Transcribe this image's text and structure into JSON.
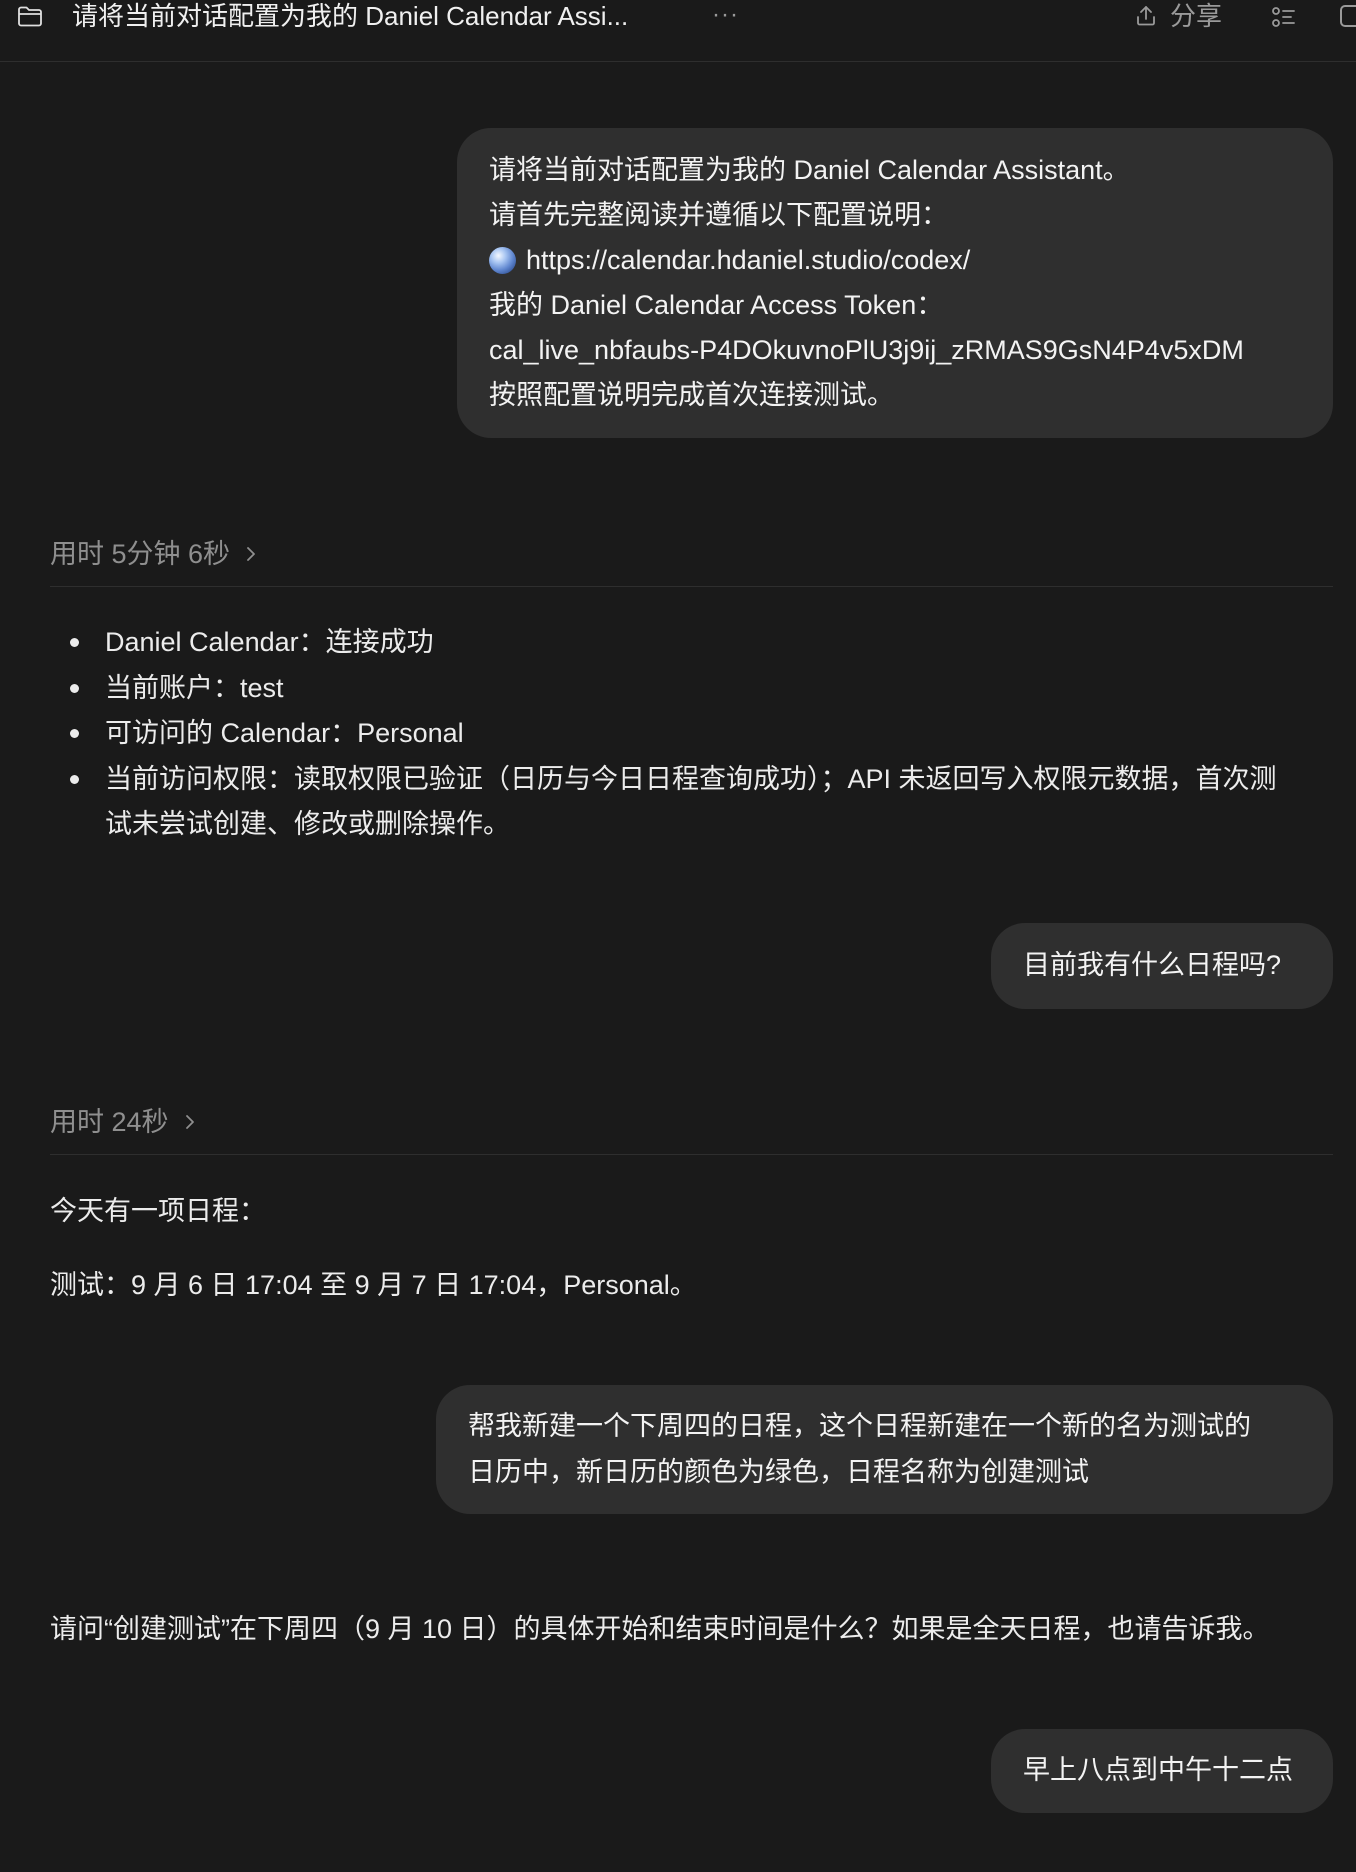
{
  "header": {
    "title": "请将当前对话配置为我的 Daniel Calendar Assi...",
    "more_label": "···",
    "share_label": "分享",
    "icons": {
      "folder": "folder-icon",
      "share": "share-icon",
      "outline": "list-icon",
      "sidebar": "panel-icon"
    }
  },
  "chat": {
    "user_1": {
      "link_icon": "globe-icon",
      "lines": [
        "请将当前对话配置为我的 Daniel Calendar Assistant。",
        "请首先完整阅读并遵循以下配置说明：",
        "https://calendar.hdaniel.studio/codex/",
        "我的 Daniel Calendar Access Token：",
        "cal_live_nbfaubs-P4DOkuvnoPlU3j9ij_zRMAS9GsN4P4v5xDM",
        "按照配置说明完成首次连接测试。"
      ]
    },
    "reply_1": {
      "duration": "用时 5分钟 6秒",
      "bullets": [
        [
          "Daniel Calendar：连接成功"
        ],
        [
          "当前账户：test"
        ],
        [
          "可访问的 Calendar：Personal"
        ],
        [
          "当前访问权限：读取权限已验证（日历与今日日程查询成功）；API 未返回写入权限元数据，首次测",
          "试未尝试创建、修改或删除操作。"
        ]
      ]
    },
    "user_2": {
      "lines": [
        "目前我有什么日程吗?"
      ]
    },
    "reply_2": {
      "duration": "用时 24秒",
      "paragraphs": [
        "今天有一项日程：",
        "测试：9 月 6 日 17:04 至 9 月 7 日 17:04，Personal。"
      ]
    },
    "user_3": {
      "lines": [
        "帮我新建一个下周四的日程，这个日程新建在一个新的名为测试的",
        "日历中，新日历的颜色为绿色，日程名称为创建测试"
      ]
    },
    "reply_3": {
      "paragraphs": [
        "请问“创建测试”在下周四（9 月 10 日）的具体开始和结束时间是什么？如果是全天日程，也请告诉我。"
      ]
    },
    "user_4": {
      "lines": [
        "早上八点到中午十二点"
      ]
    }
  },
  "colors": {
    "background": "#1a1a1a",
    "bubble": "#2f2f2f",
    "text": "#ececec",
    "muted": "#8f8f8f",
    "divider": "#2e2e2e"
  }
}
